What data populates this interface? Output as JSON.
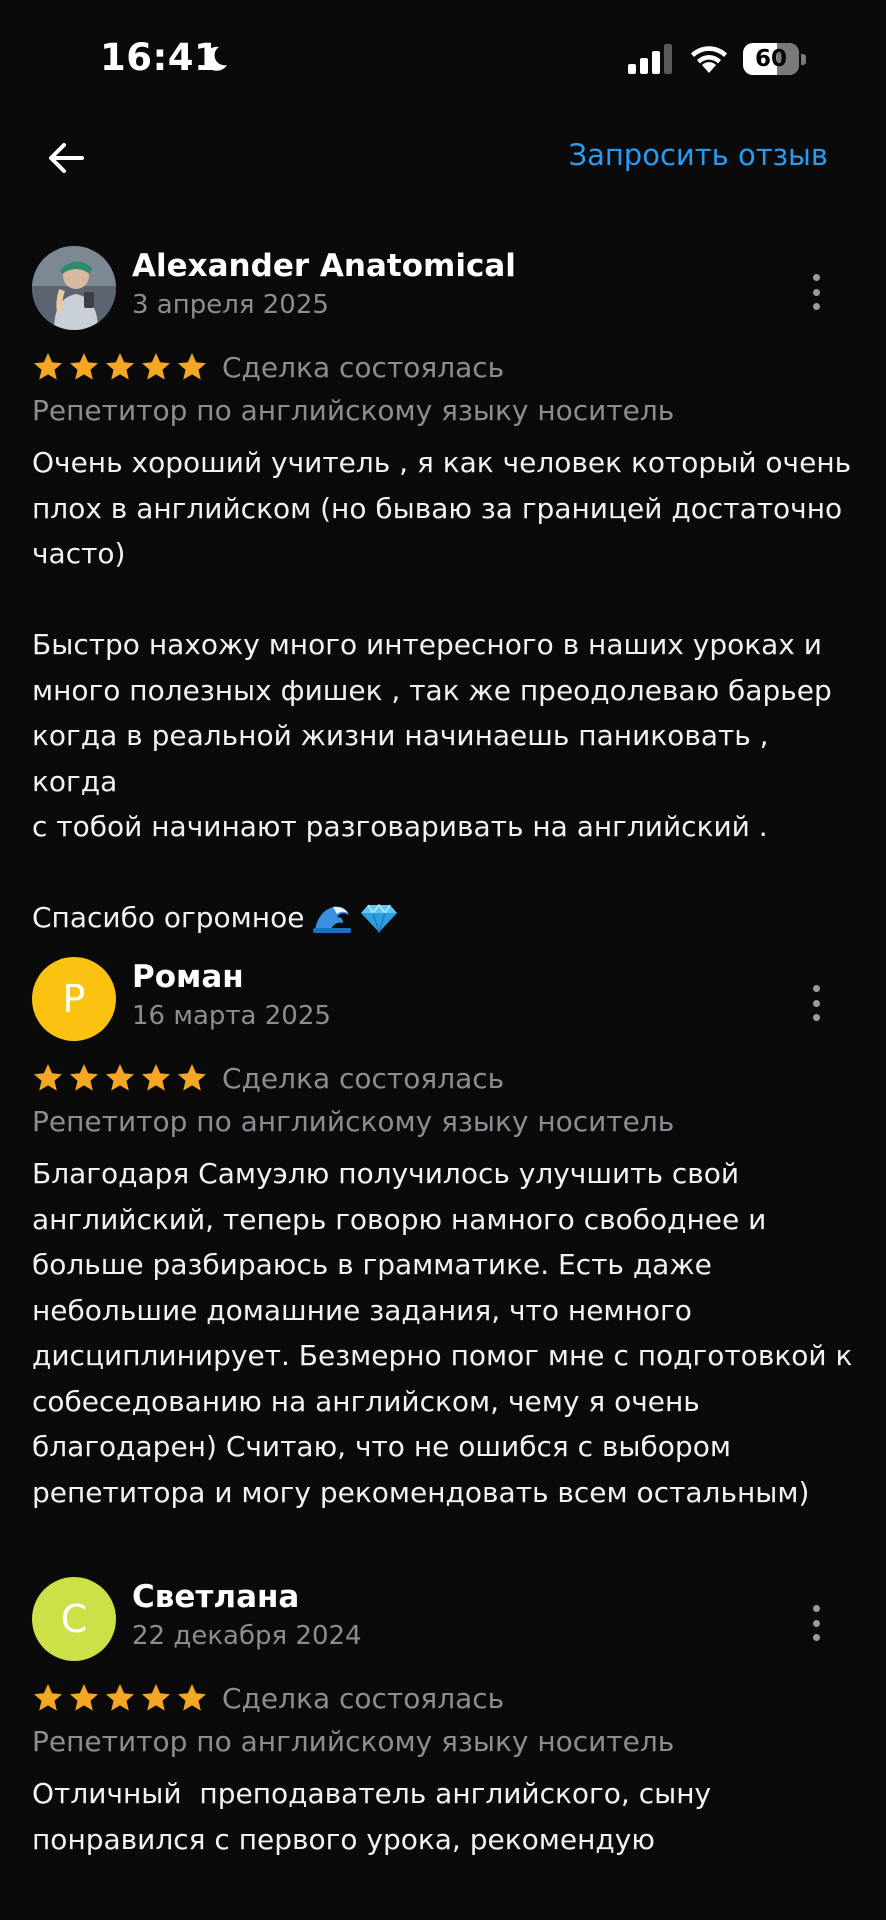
{
  "status_bar": {
    "time": "16:41",
    "battery_level": "60",
    "icons": [
      "moon-icon",
      "signal-icon",
      "wifi-icon",
      "battery-icon"
    ]
  },
  "header": {
    "back_icon": "arrow-left-icon",
    "request_review_label": "Запросить отзыв"
  },
  "colors": {
    "background": "#0a0a0b",
    "accent_link": "#2a9bf0",
    "star": "#f5a623",
    "secondary_text": "#8b8d92",
    "avatar_roman": "#fcc212",
    "avatar_svetlana": "#cde047"
  },
  "reviews": [
    {
      "name": "Alexander Anatomical",
      "date": "3 апреля 2025",
      "avatar": "photo",
      "rating": 5,
      "status": "Сделка состоялась",
      "service": "Репетитор по английскому языку носитель",
      "text": "Очень хороший учитель , я как человек который очень\nплох в английском (но бываю за границей достаточно\nчасто)\n\nБыстро нахожу много интересного в наших уроках и\nмного полезных фишек , так же преодолеваю барьер\nкогда в реальной жизни начинаешь паниковать , когда\nс тобой начинают разговаривать на английский .\n\nСпасибо огромное",
      "text_emojis": [
        "wave-emoji",
        "gem-emoji"
      ]
    },
    {
      "name": "Роман",
      "date": "16 марта 2025",
      "avatar_letter": "Р",
      "rating": 5,
      "status": "Сделка состоялась",
      "service": "Репетитор по английскому языку носитель",
      "text": "Благодаря Самуэлю получилось улучшить свой\nанглийский, теперь говорю намного свободнее и\nбольше разбираюсь в грамматике. Есть даже\nнебольшие домашние задания, что немного\nдисциплинирует. Безмерно помог мне с подготовкой к\nсобеседованию на английском, чему я очень\nблагодарен) Считаю, что не ошибся с выбором\nрепетитора и могу рекомендовать всем остальным)"
    },
    {
      "name": "Светлана",
      "date": "22 декабря 2024",
      "avatar_letter": "С",
      "rating": 5,
      "status": "Сделка состоялась",
      "service": "Репетитор по английскому языку носитель",
      "text": "Отличный  преподаватель английского, сыну\nпонравился с первого урока, рекомендую"
    }
  ]
}
